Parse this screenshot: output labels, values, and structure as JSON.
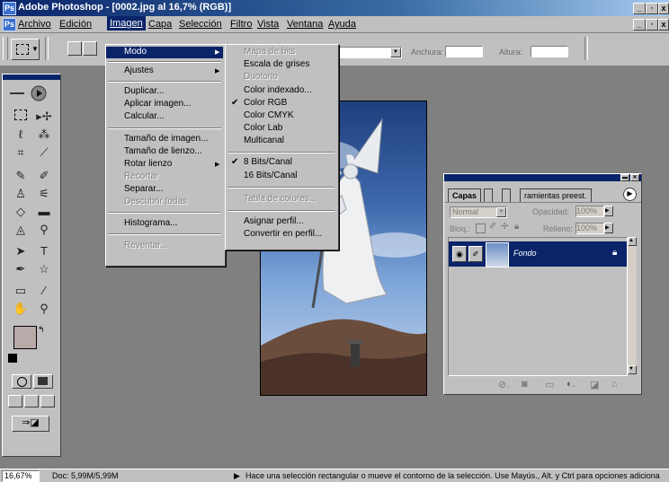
{
  "window": {
    "title": "Adobe Photoshop - [0002.jpg al 16,7% (RGB)]",
    "controls": [
      "_",
      "·",
      "x"
    ]
  },
  "menubar": {
    "items": [
      "Archivo",
      "Edición",
      "Imagen",
      "Capa",
      "Selección",
      "Filtro",
      "Vista",
      "Ventana",
      "Ayuda"
    ],
    "active": "Imagen"
  },
  "options_bar": {
    "width_label": "Anchura:",
    "height_label": "Altura:",
    "width_value": "",
    "height_value": ""
  },
  "image_menu": {
    "items": [
      {
        "label": "Modo",
        "state": "highlighted",
        "submenu": true
      },
      {
        "label": "Ajustes",
        "submenu": true
      },
      {
        "label": "Duplicar..."
      },
      {
        "label": "Aplicar imagen..."
      },
      {
        "label": "Calcular..."
      },
      {
        "label": "Tamaño de imagen..."
      },
      {
        "label": "Tamaño de lienzo..."
      },
      {
        "label": "Rotar lienzo",
        "submenu": true
      },
      {
        "label": "Recortar",
        "state": "disabled"
      },
      {
        "label": "Separar..."
      },
      {
        "label": "Descubrir todas",
        "state": "disabled"
      },
      {
        "label": "Histograma..."
      },
      {
        "label": "Reventar...",
        "state": "disabled"
      }
    ]
  },
  "mode_menu": {
    "items": [
      {
        "label": "Mapa de bits",
        "state": "disabled"
      },
      {
        "label": "Escala de grises"
      },
      {
        "label": "Duotono",
        "state": "disabled"
      },
      {
        "label": "Color indexado..."
      },
      {
        "label": "Color RGB",
        "checked": true
      },
      {
        "label": "Color CMYK"
      },
      {
        "label": "Color Lab"
      },
      {
        "label": "Multicanal"
      },
      {
        "label": "8 Bits/Canal",
        "checked": true
      },
      {
        "label": "16 Bits/Canal"
      },
      {
        "label": "Tabla de colores...",
        "state": "disabled"
      },
      {
        "label": "Asignar perfil..."
      },
      {
        "label": "Convertir en perfil..."
      }
    ]
  },
  "layers_panel": {
    "tabs": [
      "Capas",
      "",
      "",
      "ramientas preest."
    ],
    "blend_mode": "Normal",
    "opacity_label": "Opacidad:",
    "opacity_value": "100%",
    "lock_label": "Bloq.:",
    "fill_label": "Relleno:",
    "fill_value": "100%",
    "layer_name": "Fondo"
  },
  "status_bar": {
    "zoom": "16,67%",
    "doc": "Doc: 5,99M/5,99M",
    "hint": "Hace una selección rectangular o mueve el contorno de la selección. Use Mayús., Alt. y Ctrl para opciones adiciona"
  },
  "colors": {
    "title_bar": "#0a246a",
    "chrome": "#c0c0c0",
    "workspace": "#808080",
    "highlight": "#0a246a",
    "foreground_swatch": "#b8aaa8",
    "background_swatch": "#ffffff"
  }
}
